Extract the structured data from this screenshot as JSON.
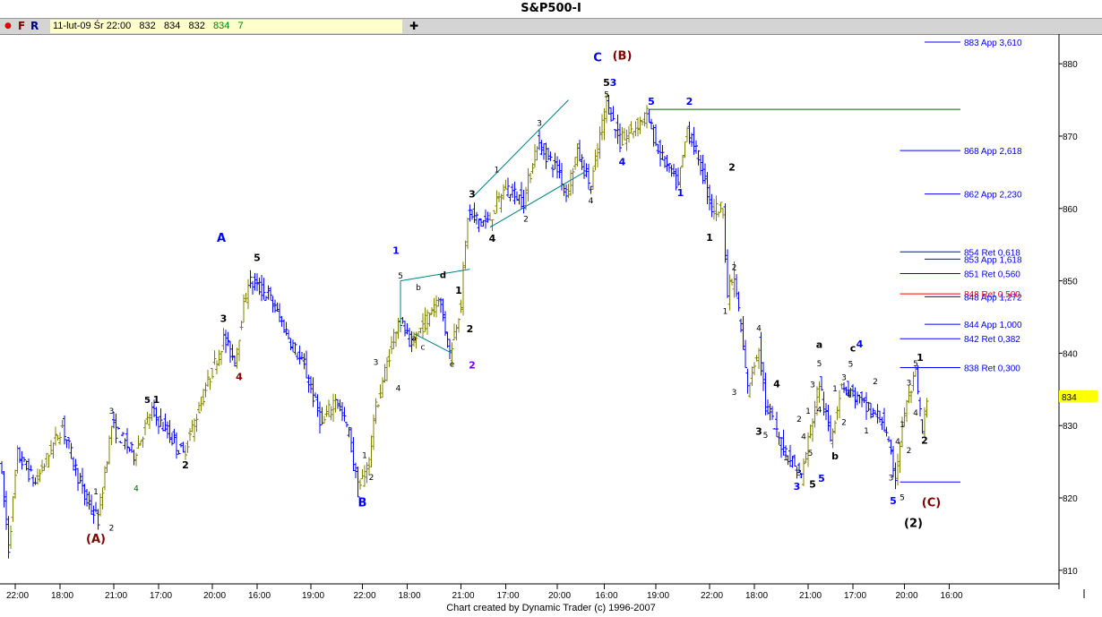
{
  "title": "S&P500-I",
  "toolbar": {
    "dot": "●",
    "f": "F",
    "r": "R",
    "plus": "✚",
    "date": "11-lut-09 Śr 22:00",
    "open": "832",
    "high": "834",
    "low": "832",
    "close": "834",
    "volume": "7"
  },
  "footer": "Chart created by Dynamic Trader  (c) 1996-2007",
  "colors": {
    "up": "#808000",
    "down": "#0000ff",
    "fib": "#0000ff",
    "fib_red": "#ff0000",
    "green": "#006400",
    "maroon": "#800000",
    "purple": "#8000ff"
  },
  "chart_data": {
    "type": "ohlc",
    "title": "S&P500-I",
    "ylim": [
      805,
      888
    ],
    "y_ticks": [
      810,
      820,
      830,
      840,
      850,
      860,
      870,
      880
    ],
    "last_price": "834",
    "x_ticks": [
      [
        6,
        "22:00"
      ],
      [
        26,
        "18:00"
      ],
      [
        50,
        "21:00"
      ],
      [
        70,
        "17:00"
      ],
      [
        94,
        "20:00"
      ],
      [
        114,
        "16:00"
      ],
      [
        138,
        "19:00"
      ],
      [
        161,
        "22:00"
      ],
      [
        181,
        "18:00"
      ],
      [
        205,
        "21:00"
      ],
      [
        225,
        "17:00"
      ],
      [
        248,
        "20:00"
      ],
      [
        269,
        "16:00"
      ],
      [
        292,
        "19:00"
      ],
      [
        316,
        "22:00"
      ],
      [
        336,
        "18:00"
      ],
      [
        360,
        "21:00"
      ],
      [
        380,
        "17:00"
      ],
      [
        403,
        "20:00"
      ],
      [
        423,
        "16:00"
      ]
    ],
    "price_path": [
      [
        0,
        826
      ],
      [
        4,
        813
      ],
      [
        8,
        826
      ],
      [
        16,
        822
      ],
      [
        28,
        830
      ],
      [
        38,
        820
      ],
      [
        44,
        817
      ],
      [
        50,
        830
      ],
      [
        60,
        826
      ],
      [
        68,
        832
      ],
      [
        82,
        826
      ],
      [
        92,
        835
      ],
      [
        100,
        842
      ],
      [
        105,
        839
      ],
      [
        111,
        850
      ],
      [
        120,
        848
      ],
      [
        136,
        838
      ],
      [
        144,
        830
      ],
      [
        150,
        834
      ],
      [
        156,
        829
      ],
      [
        160,
        821
      ],
      [
        165,
        825
      ],
      [
        167,
        831
      ],
      [
        178,
        845
      ],
      [
        184,
        841
      ],
      [
        196,
        848
      ],
      [
        201,
        840
      ],
      [
        206,
        847
      ],
      [
        209,
        859
      ],
      [
        218,
        858
      ],
      [
        226,
        863
      ],
      [
        234,
        861
      ],
      [
        240,
        869
      ],
      [
        250,
        865
      ],
      [
        253,
        862
      ],
      [
        258,
        868
      ],
      [
        264,
        863
      ],
      [
        271,
        875
      ],
      [
        277,
        869
      ],
      [
        289,
        873
      ],
      [
        294,
        868
      ],
      [
        303,
        863
      ],
      [
        307,
        871
      ],
      [
        312,
        867
      ],
      [
        318,
        860
      ],
      [
        323,
        860
      ],
      [
        325,
        848
      ],
      [
        328,
        851
      ],
      [
        334,
        835
      ],
      [
        339,
        841
      ],
      [
        342,
        833
      ],
      [
        348,
        828
      ],
      [
        352,
        826
      ],
      [
        358,
        823
      ],
      [
        366,
        836
      ],
      [
        371,
        828
      ],
      [
        376,
        836
      ],
      [
        388,
        832
      ],
      [
        394,
        831
      ],
      [
        400,
        823
      ],
      [
        404,
        832
      ],
      [
        409,
        837
      ],
      [
        412,
        829
      ],
      [
        414,
        833
      ]
    ],
    "fib_levels": [
      {
        "price": 883,
        "label": "883 App 3,610",
        "from": 412,
        "color": "fib"
      },
      {
        "price": 868,
        "label": "868 App 2,618",
        "from": 401,
        "color": "fib"
      },
      {
        "price": 862,
        "label": "862 App 2,230",
        "from": 412,
        "color": "fib"
      },
      {
        "price": 854,
        "label": "854 Ret 0,618",
        "from": 401,
        "color": "fib"
      },
      {
        "price": 853,
        "label": "853 App 1,618",
        "from": 412,
        "color": "fib"
      },
      {
        "price": 851,
        "label": "851 Ret 0,560",
        "from": 401,
        "color": "fib"
      },
      {
        "price": 848.2,
        "label": "848 Ret 0,500",
        "from": 401,
        "color": "fib_red"
      },
      {
        "price": 847.8,
        "label": "848 App 1,272",
        "from": 412,
        "color": "fib"
      },
      {
        "price": 844,
        "label": "844 App 1,000",
        "from": 412,
        "color": "fib"
      },
      {
        "price": 842,
        "label": "842 Ret 0,382",
        "from": 401,
        "color": "fib"
      },
      {
        "price": 838,
        "label": "838 Ret 0,300",
        "from": 401,
        "color": "fib"
      }
    ],
    "lines": [
      {
        "p": [
          [
            289,
            873.7
          ],
          [
            428,
            873.7
          ]
        ],
        "color": "green"
      },
      {
        "p": [
          [
            401,
            822.2
          ],
          [
            428,
            822.2
          ]
        ],
        "color": "fib"
      },
      {
        "p": [
          [
            211,
            861.8
          ],
          [
            253,
            875
          ]
        ],
        "color": "#008080"
      },
      {
        "p": [
          [
            218,
            857.4
          ],
          [
            260,
            865
          ]
        ],
        "color": "#008080"
      },
      {
        "p": [
          [
            178,
            850
          ],
          [
            209,
            851.6
          ]
        ],
        "color": "#008080"
      },
      {
        "p": [
          [
            178,
            850
          ],
          [
            178,
            843
          ]
        ],
        "color": "#008080"
      },
      {
        "p": [
          [
            184,
            842.7
          ],
          [
            201,
            840
          ]
        ],
        "color": "#008080"
      }
    ],
    "wave_labels": [
      {
        "x": 42,
        "p": 814.3,
        "t": "(A)",
        "c": "maroon",
        "s": 13
      },
      {
        "x": 49,
        "p": 832.1,
        "t": "3",
        "c": "#000",
        "s": 9
      },
      {
        "x": 42,
        "p": 821,
        "t": "1",
        "c": "#000",
        "s": 9
      },
      {
        "x": 49,
        "p": 816,
        "t": "2",
        "c": "#000",
        "s": 9
      },
      {
        "x": 60,
        "p": 821.4,
        "t": "4",
        "c": "green",
        "s": 9
      },
      {
        "x": 65,
        "p": 833.6,
        "t": "5",
        "c": "#000",
        "s": 10
      },
      {
        "x": 69,
        "p": 833.6,
        "t": "1",
        "c": "#000",
        "s": 11
      },
      {
        "x": 82,
        "p": 824.6,
        "t": "2",
        "c": "#000",
        "s": 11
      },
      {
        "x": 99,
        "p": 844.8,
        "t": "3",
        "c": "#000",
        "s": 11
      },
      {
        "x": 106,
        "p": 836.8,
        "t": "4",
        "c": "maroon",
        "s": 11
      },
      {
        "x": 114,
        "p": 853.2,
        "t": "5",
        "c": "#000",
        "s": 11
      },
      {
        "x": 98,
        "p": 855.9,
        "t": "A",
        "c": "fib",
        "s": 13
      },
      {
        "x": 161,
        "p": 819.3,
        "t": "B",
        "c": "fib",
        "s": 13
      },
      {
        "x": 162,
        "p": 826,
        "t": "1",
        "c": "#000",
        "s": 9
      },
      {
        "x": 165,
        "p": 823,
        "t": "2",
        "c": "#000",
        "s": 9
      },
      {
        "x": 167,
        "p": 838.9,
        "t": "3",
        "c": "#000",
        "s": 9
      },
      {
        "x": 177,
        "p": 835.3,
        "t": "4",
        "c": "#000",
        "s": 9
      },
      {
        "x": 176,
        "p": 854.2,
        "t": "1",
        "c": "fib",
        "s": 11
      },
      {
        "x": 178,
        "p": 850.8,
        "t": "5",
        "c": "#000",
        "s": 9
      },
      {
        "x": 186,
        "p": 849.2,
        "t": "b",
        "c": "#000",
        "s": 9
      },
      {
        "x": 184,
        "p": 842.2,
        "t": "a",
        "c": "#000",
        "s": 9
      },
      {
        "x": 188,
        "p": 841,
        "t": "c",
        "c": "#000",
        "s": 9
      },
      {
        "x": 197,
        "p": 850.9,
        "t": "d",
        "c": "#000",
        "s": 10
      },
      {
        "x": 201,
        "p": 838.6,
        "t": "e",
        "c": "#000",
        "s": 9
      },
      {
        "x": 204,
        "p": 848.7,
        "t": "1",
        "c": "#000",
        "s": 11
      },
      {
        "x": 209,
        "p": 843.4,
        "t": "2",
        "c": "#000",
        "s": 11
      },
      {
        "x": 210,
        "p": 838.4,
        "t": "2",
        "c": "purple",
        "s": 11
      },
      {
        "x": 210,
        "p": 862,
        "t": "3",
        "c": "#000",
        "s": 11
      },
      {
        "x": 219,
        "p": 855.9,
        "t": "4",
        "c": "#000",
        "s": 11
      },
      {
        "x": 221,
        "p": 865.5,
        "t": "1",
        "c": "#000",
        "s": 9
      },
      {
        "x": 234,
        "p": 858.7,
        "t": "2",
        "c": "#000",
        "s": 9
      },
      {
        "x": 240,
        "p": 871.9,
        "t": "3",
        "c": "#000",
        "s": 9
      },
      {
        "x": 263,
        "p": 861.2,
        "t": "4",
        "c": "#000",
        "s": 9
      },
      {
        "x": 266,
        "p": 880.8,
        "t": "C",
        "c": "fib",
        "s": 13
      },
      {
        "x": 277,
        "p": 881.1,
        "t": "(B)",
        "c": "maroon",
        "s": 13
      },
      {
        "x": 270,
        "p": 877.4,
        "t": "5",
        "c": "#000",
        "s": 11
      },
      {
        "x": 273,
        "p": 877.4,
        "t": "3",
        "c": "fib",
        "s": 11
      },
      {
        "x": 270,
        "p": 875.9,
        "t": "5",
        "c": "#000",
        "s": 9
      },
      {
        "x": 277,
        "p": 866.5,
        "t": "4",
        "c": "fib",
        "s": 11
      },
      {
        "x": 290,
        "p": 874.8,
        "t": "5",
        "c": "fib",
        "s": 11
      },
      {
        "x": 307,
        "p": 874.8,
        "t": "2",
        "c": "fib",
        "s": 11
      },
      {
        "x": 303,
        "p": 862.2,
        "t": "1",
        "c": "fib",
        "s": 11
      },
      {
        "x": 326,
        "p": 865.7,
        "t": "2",
        "c": "#000",
        "s": 11
      },
      {
        "x": 316,
        "p": 856,
        "t": "1",
        "c": "#000",
        "s": 11
      },
      {
        "x": 327,
        "p": 852,
        "t": "2",
        "c": "#000",
        "s": 9
      },
      {
        "x": 323,
        "p": 845.9,
        "t": "1",
        "c": "#000",
        "s": 9
      },
      {
        "x": 338,
        "p": 843.6,
        "t": "4",
        "c": "#000",
        "s": 9
      },
      {
        "x": 327,
        "p": 834.7,
        "t": "3",
        "c": "#000",
        "s": 9
      },
      {
        "x": 346,
        "p": 835.8,
        "t": "4",
        "c": "#000",
        "s": 11
      },
      {
        "x": 338,
        "p": 829.2,
        "t": "3",
        "c": "#000",
        "s": 11
      },
      {
        "x": 341,
        "p": 828.8,
        "t": "5",
        "c": "#000",
        "s": 9
      },
      {
        "x": 365,
        "p": 841.2,
        "t": "a",
        "c": "#000",
        "s": 11
      },
      {
        "x": 365,
        "p": 838.7,
        "t": "5",
        "c": "#000",
        "s": 9
      },
      {
        "x": 362,
        "p": 835.8,
        "t": "3",
        "c": "#000",
        "s": 9
      },
      {
        "x": 360,
        "p": 832.1,
        "t": "1",
        "c": "#000",
        "s": 9
      },
      {
        "x": 356,
        "p": 831,
        "t": "2",
        "c": "#000",
        "s": 9
      },
      {
        "x": 350,
        "p": 825.7,
        "t": "1",
        "c": "#000",
        "s": 9
      },
      {
        "x": 356,
        "p": 823.6,
        "t": "3",
        "c": "#000",
        "s": 9
      },
      {
        "x": 358,
        "p": 828.6,
        "t": "4",
        "c": "#000",
        "s": 9
      },
      {
        "x": 361,
        "p": 826.3,
        "t": "5",
        "c": "#000",
        "s": 9
      },
      {
        "x": 362,
        "p": 821.9,
        "t": "5",
        "c": "#000",
        "s": 11
      },
      {
        "x": 355,
        "p": 821.6,
        "t": "3",
        "c": "fib",
        "s": 11
      },
      {
        "x": 366,
        "p": 822.7,
        "t": "5",
        "c": "fib",
        "s": 11
      },
      {
        "x": 372,
        "p": 825.8,
        "t": "b",
        "c": "#000",
        "s": 11
      },
      {
        "x": 380,
        "p": 840.7,
        "t": "c",
        "c": "#000",
        "s": 11
      },
      {
        "x": 383,
        "p": 841.3,
        "t": "4",
        "c": "fib",
        "s": 11
      },
      {
        "x": 379,
        "p": 838.6,
        "t": "5",
        "c": "#000",
        "s": 9
      },
      {
        "x": 372,
        "p": 835.2,
        "t": "1",
        "c": "#000",
        "s": 9
      },
      {
        "x": 376,
        "p": 836.8,
        "t": "3",
        "c": "#000",
        "s": 9
      },
      {
        "x": 378,
        "p": 834.5,
        "t": "4",
        "c": "#000",
        "s": 9
      },
      {
        "x": 376,
        "p": 830.6,
        "t": "2",
        "c": "#000",
        "s": 9
      },
      {
        "x": 365,
        "p": 832.3,
        "t": "4",
        "c": "#000",
        "s": 9
      },
      {
        "x": 390,
        "p": 836.2,
        "t": "2",
        "c": "#000",
        "s": 9
      },
      {
        "x": 386,
        "p": 829.4,
        "t": "1",
        "c": "#000",
        "s": 9
      },
      {
        "x": 397,
        "p": 822.9,
        "t": "3",
        "c": "#000",
        "s": 9
      },
      {
        "x": 400,
        "p": 827.9,
        "t": "4",
        "c": "#000",
        "s": 9
      },
      {
        "x": 405,
        "p": 826.7,
        "t": "2",
        "c": "#000",
        "s": 9
      },
      {
        "x": 402,
        "p": 830.3,
        "t": "1",
        "c": "#000",
        "s": 9
      },
      {
        "x": 398,
        "p": 819.6,
        "t": "5",
        "c": "fib",
        "s": 11
      },
      {
        "x": 402,
        "p": 820.2,
        "t": "5",
        "c": "#000",
        "s": 9
      },
      {
        "x": 415,
        "p": 819.3,
        "t": "(C)",
        "c": "maroon",
        "s": 13
      },
      {
        "x": 407,
        "p": 816.5,
        "t": "(2)",
        "c": "#000",
        "s": 13
      },
      {
        "x": 405,
        "p": 836,
        "t": "3",
        "c": "#000",
        "s": 9
      },
      {
        "x": 408,
        "p": 838.7,
        "t": "5",
        "c": "#000",
        "s": 9
      },
      {
        "x": 410,
        "p": 839.4,
        "t": "1",
        "c": "#000",
        "s": 11
      },
      {
        "x": 408,
        "p": 831.9,
        "t": "4",
        "c": "#000",
        "s": 9
      },
      {
        "x": 412,
        "p": 828,
        "t": "2",
        "c": "#000",
        "s": 11
      }
    ]
  }
}
